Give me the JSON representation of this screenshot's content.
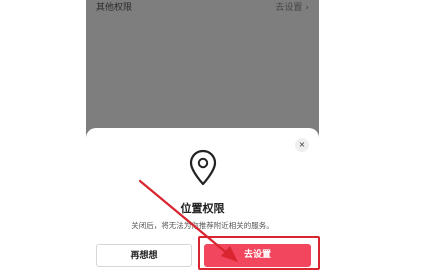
{
  "permission_row": {
    "label": "其他权限",
    "action": "去设置",
    "chevron": "›"
  },
  "dialog": {
    "close_glyph": "×",
    "icon": "location-pin-icon",
    "title": "位置权限",
    "description": "关闭后，将无法为你推荐附近相关的服务。",
    "buttons": {
      "secondary": "再想想",
      "primary": "去设置"
    }
  },
  "colors": {
    "primary": "#f2465e",
    "annotation": "#d8252f",
    "overlay": "#7e7e7e"
  }
}
